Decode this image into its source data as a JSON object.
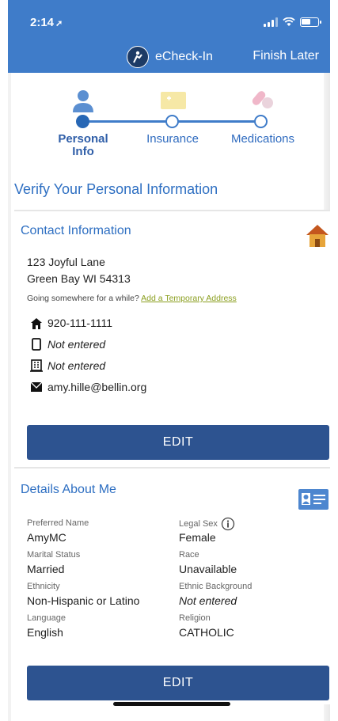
{
  "status_bar": {
    "time": "2:14"
  },
  "header": {
    "app_name": "eCheck-In",
    "finish_later": "Finish Later"
  },
  "stepper": {
    "steps": [
      {
        "label": "Personal Info",
        "state": "active",
        "icon": "person-icon"
      },
      {
        "label": "Insurance",
        "state": "pending",
        "icon": "insurance-card-icon"
      },
      {
        "label": "Medications",
        "state": "pending",
        "icon": "pill-icon"
      }
    ]
  },
  "page_title": "Verify Your Personal Information",
  "contact": {
    "title": "Contact Information",
    "address_line1": "123 Joyful Lane",
    "address_line2": "Green Bay WI 54313",
    "temp_hint": "Going somewhere for a while?",
    "temp_link": "Add a Temporary Address",
    "home_phone": "920-111-1111",
    "mobile_phone": "Not entered",
    "work_phone": "Not entered",
    "email": "amy.hille@bellin.org",
    "edit": "EDIT"
  },
  "details": {
    "title": "Details About Me",
    "preferred_name_label": "Preferred Name",
    "preferred_name": "AmyMC",
    "legal_sex_label": "Legal Sex",
    "legal_sex": "Female",
    "marital_status_label": "Marital Status",
    "marital_status": "Married",
    "race_label": "Race",
    "race": "Unavailable",
    "ethnicity_label": "Ethnicity",
    "ethnicity": "Non-Hispanic or Latino",
    "ethnic_background_label": "Ethnic Background",
    "ethnic_background": "Not entered",
    "language_label": "Language",
    "language": "English",
    "religion_label": "Religion",
    "religion": "CATHOLIC",
    "edit": "EDIT"
  },
  "colors": {
    "header_blue": "#3f7cc9",
    "title_blue": "#2e6fc2",
    "button_navy": "#2d5390",
    "link_green": "#8a9e1e"
  }
}
